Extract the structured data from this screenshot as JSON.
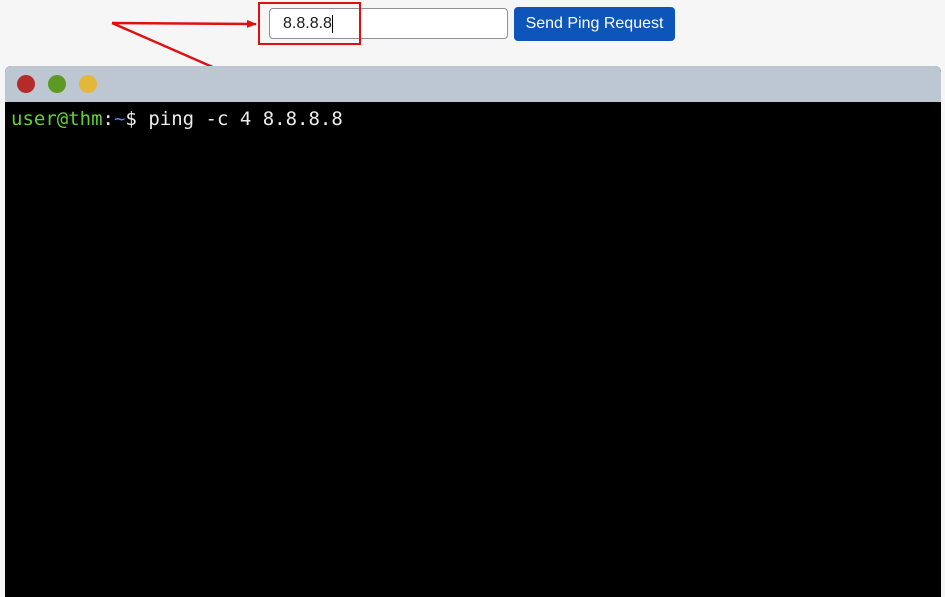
{
  "ping_form": {
    "input_value": "8.8.8.8",
    "button_label": "Send Ping Request"
  },
  "terminal": {
    "window_buttons": [
      {
        "name": "close",
        "color": "#b52a2a"
      },
      {
        "name": "minimize",
        "color": "#5d9a24"
      },
      {
        "name": "maximize",
        "color": "#e2b73a"
      }
    ],
    "prompt_user_host": "user@thm",
    "prompt_colon": ":",
    "prompt_path": "~",
    "prompt_symbol": "$",
    "command": " ping -c 4 8.8.8.8",
    "colors": {
      "user_host": "#63d132",
      "path": "#4f86f7",
      "text": "#ececec"
    }
  },
  "annotation": {
    "color": "#e01010"
  }
}
